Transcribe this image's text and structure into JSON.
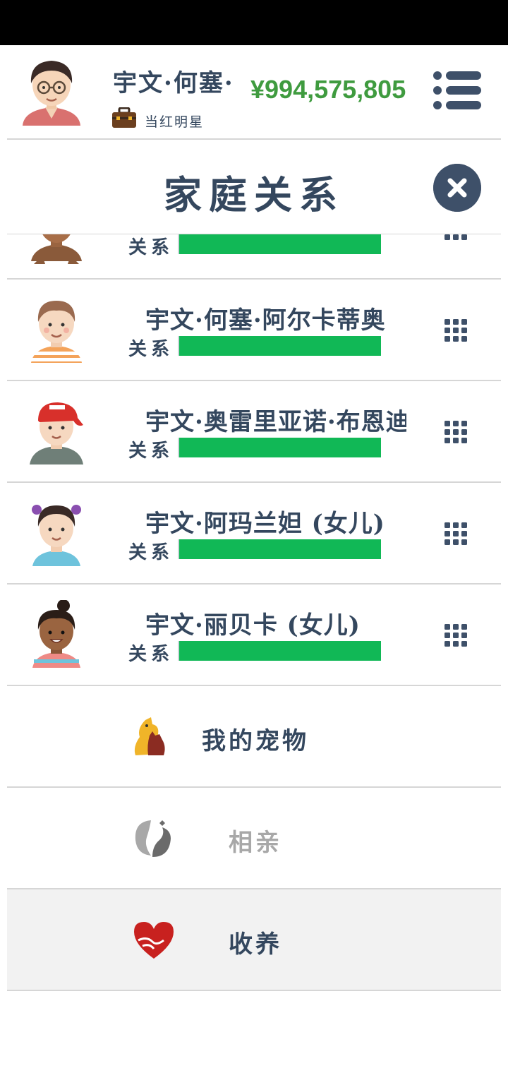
{
  "header": {
    "player_name": "宇文·何塞·",
    "job_label": "当红明星",
    "money": "¥994,575,805"
  },
  "panel": {
    "title": "家庭关系"
  },
  "relation_label": "关系",
  "members": [
    {
      "name": "",
      "relationship": 1.0,
      "avatar": "girl-dark-avatar"
    },
    {
      "name": "宇文·何塞·阿尔卡蒂奥",
      "relationship": 1.0,
      "avatar": "boy-striped-shirt-avatar"
    },
    {
      "name": "宇文·奥雷里亚诺·布恩迪",
      "relationship": 1.0,
      "avatar": "boy-red-cap-avatar"
    },
    {
      "name": "宇文·阿玛兰妲 (女儿)",
      "relationship": 1.0,
      "avatar": "girl-pigtails-avatar"
    },
    {
      "name": "宇文·丽贝卡 (女儿)",
      "relationship": 1.0,
      "avatar": "girl-bun-avatar"
    }
  ],
  "actions": {
    "pets": "我的宠物",
    "dating": "相亲",
    "adopt": "收养"
  },
  "colors": {
    "accent_text": "#34475e",
    "money": "#3f9b3f",
    "relationship_bar": "#11b856",
    "close_button": "#3e5069"
  }
}
